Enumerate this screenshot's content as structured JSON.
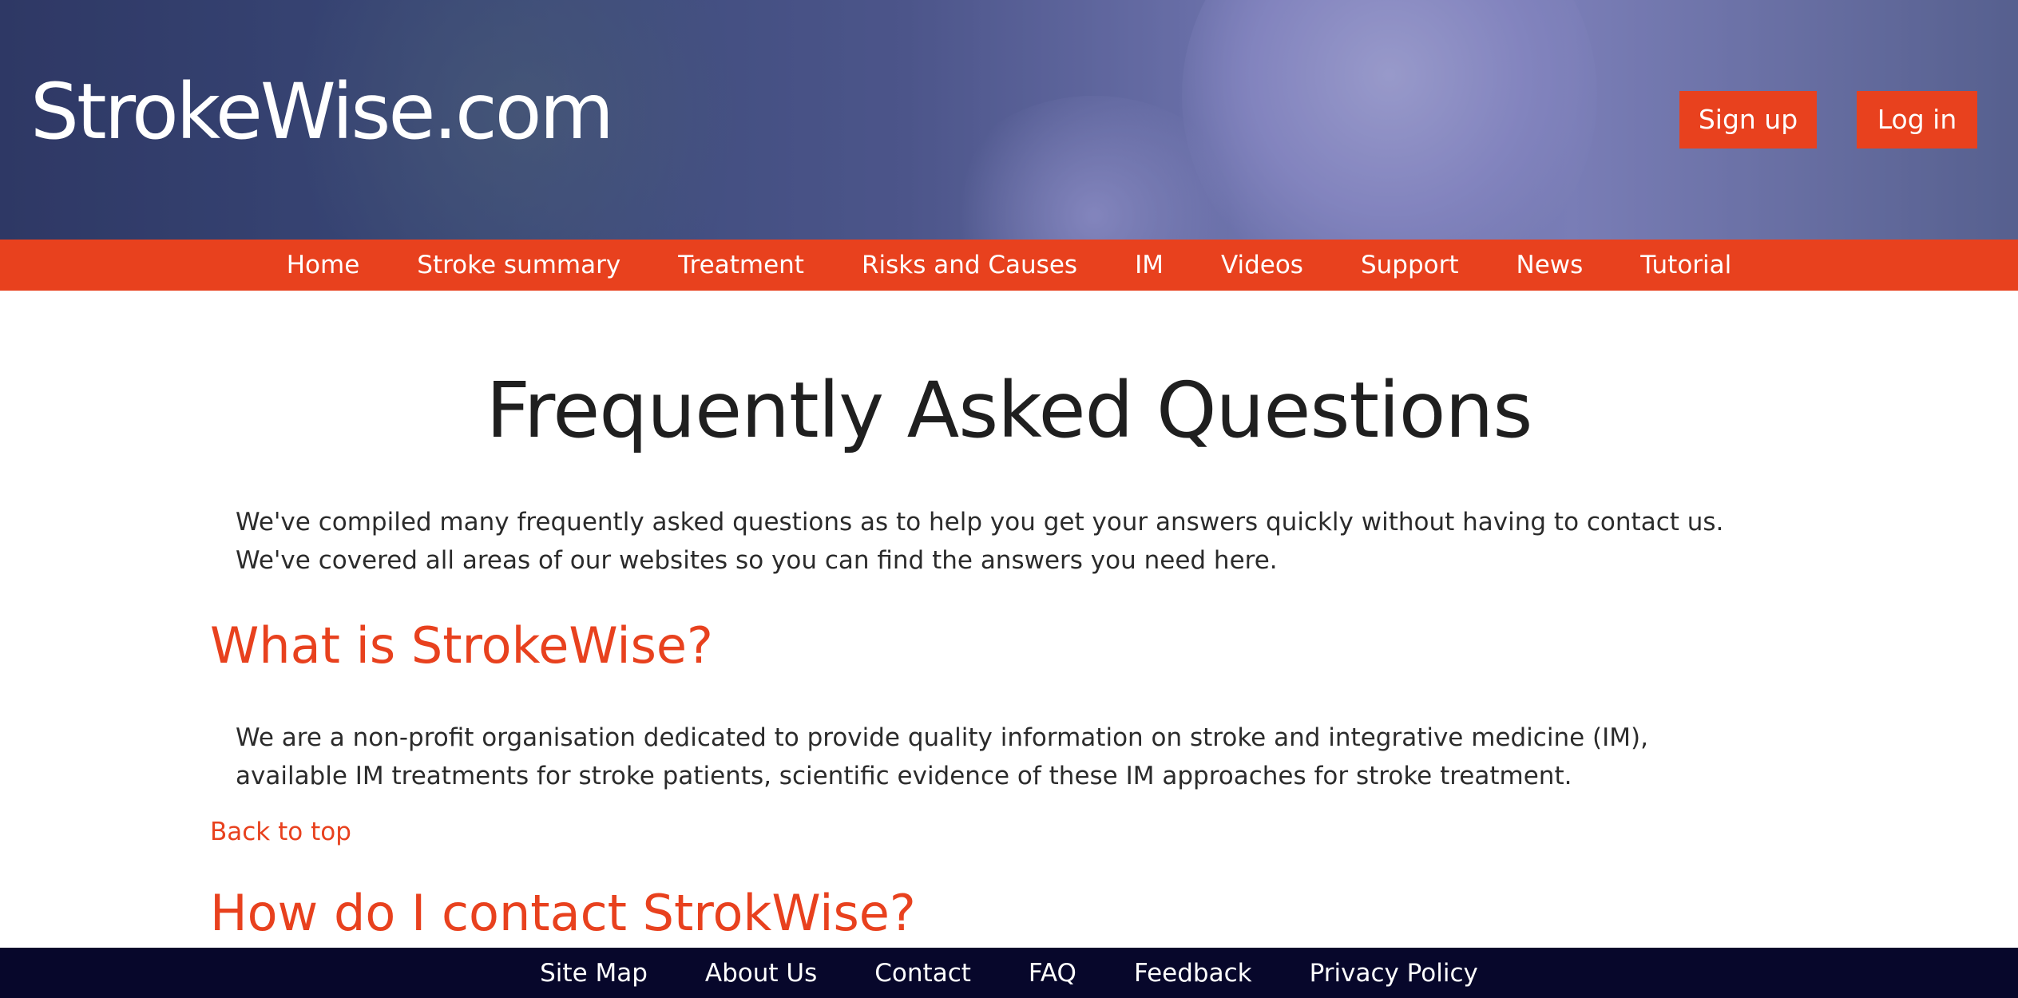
{
  "header": {
    "logo_text": "StrokeWise.com",
    "signup_label": "Sign up",
    "login_label": "Log in"
  },
  "nav": {
    "items": [
      {
        "label": "Home"
      },
      {
        "label": "Stroke summary"
      },
      {
        "label": "Treatment"
      },
      {
        "label": "Risks and Causes"
      },
      {
        "label": "IM"
      },
      {
        "label": "Videos"
      },
      {
        "label": "Support"
      },
      {
        "label": "News"
      },
      {
        "label": "Tutorial"
      }
    ]
  },
  "main": {
    "title": "Frequently Asked Questions",
    "intro": "We've compiled many frequently asked questions as to help you get your answers quickly without having to contact us. We've covered all areas of our websites so you can find the answers you need here.",
    "faqs": [
      {
        "question": "What is StrokeWise?",
        "answer": "We are a non-profit organisation dedicated to provide quality information on stroke and integrative medicine (IM), available IM treatments for stroke patients, scientific evidence of these IM approaches for stroke treatment."
      },
      {
        "question": "How do I contact StrokWise?"
      }
    ],
    "back_to_top": "Back to top"
  },
  "footer": {
    "items": [
      {
        "label": "Site Map"
      },
      {
        "label": "About Us"
      },
      {
        "label": "Contact"
      },
      {
        "label": "FAQ"
      },
      {
        "label": "Feedback"
      },
      {
        "label": "Privacy Policy"
      }
    ]
  },
  "colors": {
    "accent": "#e8411e",
    "footer_bg": "#07072b",
    "hero_tint": "#5a62a0"
  }
}
